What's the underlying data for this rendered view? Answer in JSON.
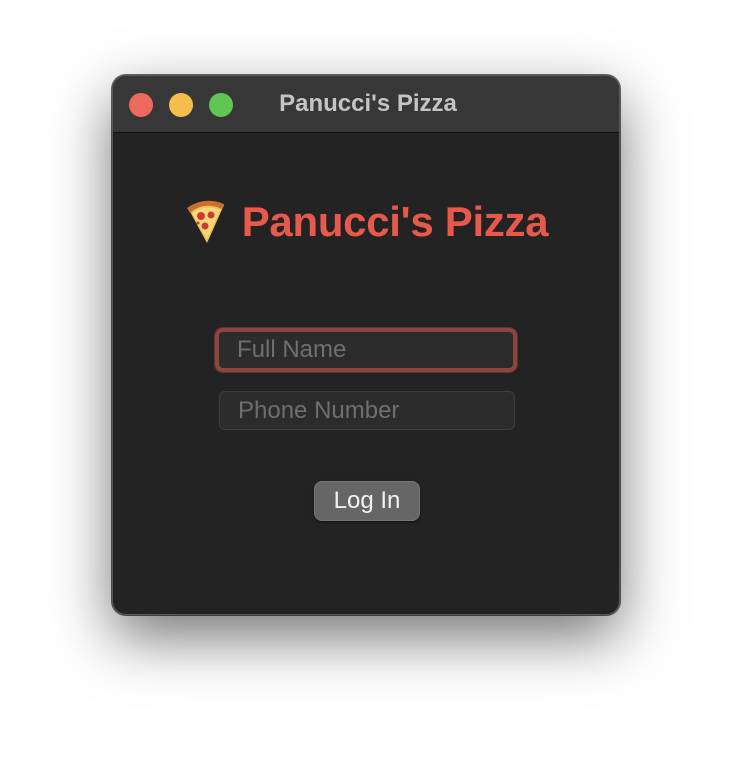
{
  "window": {
    "title": "Panucci's Pizza",
    "traffic_lights": {
      "close_color": "#ec6a5e",
      "minimize_color": "#f4be4f",
      "zoom_color": "#61c554"
    }
  },
  "brand": {
    "icon": "pizza-slice-icon",
    "title": "Panucci's Pizza",
    "title_color": "#e8594d"
  },
  "form": {
    "full_name": {
      "placeholder": "Full Name",
      "value": ""
    },
    "phone_number": {
      "placeholder": "Phone Number",
      "value": ""
    },
    "login_label": "Log In"
  }
}
